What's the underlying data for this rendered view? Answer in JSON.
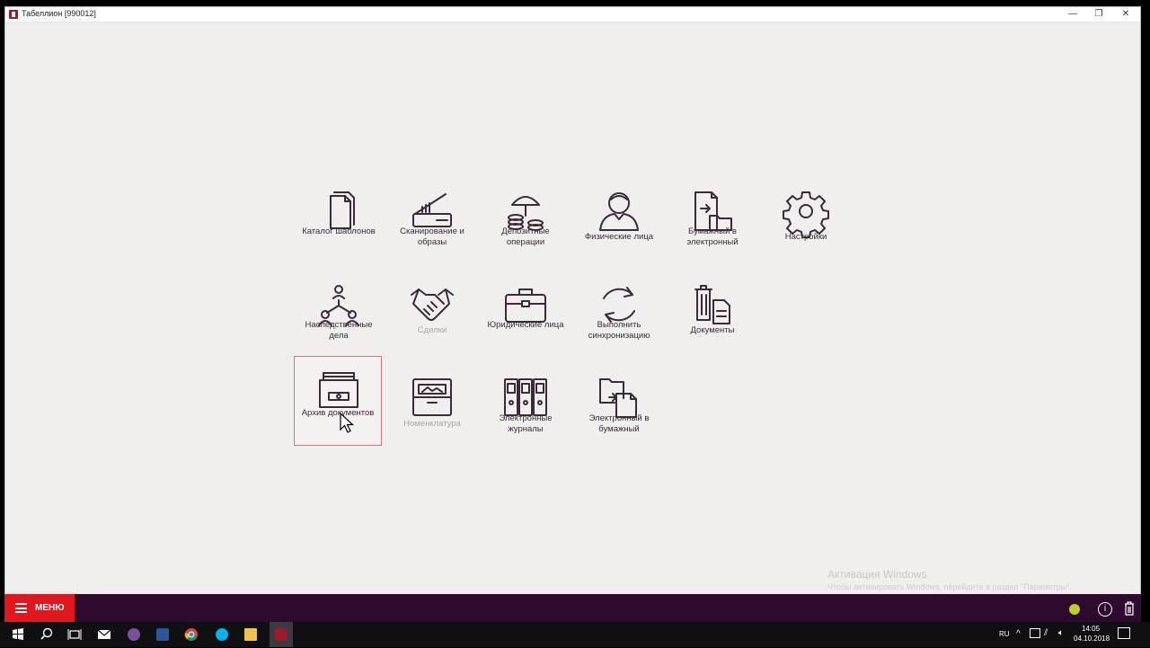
{
  "window": {
    "title": "Табеллион [990012]",
    "minimize_glyph": "—",
    "maximize_glyph": "❐",
    "close_glyph": "✕"
  },
  "menu": {
    "row1": [
      {
        "label": "Каталог шаблонов",
        "icon": "documents-stack-icon"
      },
      {
        "label": "Сканирование и образы",
        "icon": "scanner-icon"
      },
      {
        "label": "Депозитные операции",
        "icon": "coins-umbrella-icon"
      },
      {
        "label": "Физические лица",
        "icon": "person-icon"
      },
      {
        "label": "Бумажный в электронный",
        "icon": "paper-to-digital-icon"
      },
      {
        "label": "Настройки",
        "icon": "gear-icon"
      }
    ],
    "row2": [
      {
        "label": "Наследственные дела",
        "icon": "family-tree-icon"
      },
      {
        "label": "Сделки",
        "icon": "handshake-icon",
        "disabled": true
      },
      {
        "label": "Юридические лица",
        "icon": "briefcase-icon"
      },
      {
        "label": "Выполнить синхронизацию",
        "icon": "sync-icon"
      },
      {
        "label": "Документы",
        "icon": "documents-trash-icon"
      }
    ],
    "row3": [
      {
        "label": "Архив документов",
        "icon": "archive-box-icon",
        "selected": true
      },
      {
        "label": "Номенклатура",
        "icon": "cabinet-icon",
        "disabled": true
      },
      {
        "label": "Электронные журналы",
        "icon": "binders-icon"
      },
      {
        "label": "Электронный в бумажный",
        "icon": "digital-to-paper-icon"
      }
    ]
  },
  "footer": {
    "menu_label": "МЕНЮ",
    "status_color": "#b7d22b",
    "info_glyph": "i"
  },
  "watermark": {
    "title": "Активация Windows",
    "subtitle": "Чтобы активировать Windows, перейдите в раздел \"Параметры\"."
  },
  "taskbar": {
    "language": "RU",
    "time": "14:05",
    "date": "04.10.2018"
  },
  "colors": {
    "accent": "#e1161f",
    "bar": "#2f0a2f",
    "icon_stroke": "#3a2a3a",
    "selected_border": "#d9737e"
  }
}
